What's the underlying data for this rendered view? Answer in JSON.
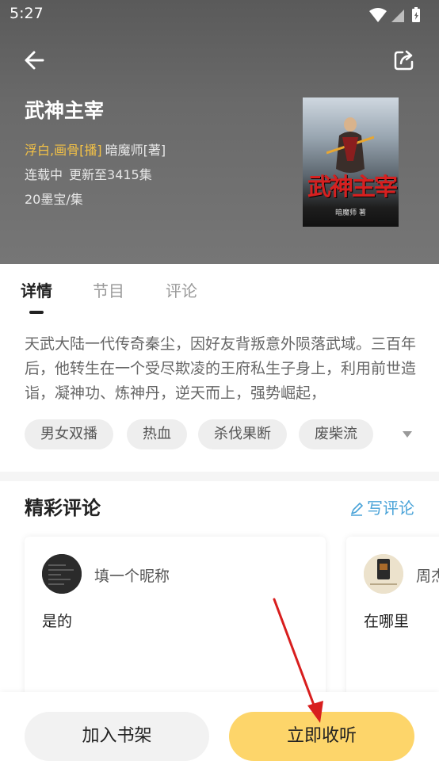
{
  "status_bar": {
    "time": "5:27",
    "icons": [
      "wifi-icon",
      "signal-icon",
      "battery-icon"
    ]
  },
  "header": {
    "back_icon": "back-arrow-icon",
    "share_icon": "share-icon"
  },
  "book": {
    "title": "武神主宰",
    "narrators": "浮白,画骨[播]",
    "author": "暗魔师[著]",
    "status": "连载中",
    "update": "更新至3415集",
    "price": "20墨宝/集",
    "cover": {
      "title": "武神主宰",
      "author": "暗魔师 著"
    }
  },
  "tabs": [
    {
      "label": "详情",
      "active": true
    },
    {
      "label": "节目",
      "active": false
    },
    {
      "label": "评论",
      "active": false
    }
  ],
  "description": "天武大陆一代传奇秦尘，因好友背叛意外陨落武域。三百年后，他转生在一个受尽欺凌的王府私生子身上，利用前世造诣，凝神功、炼神丹，逆天而上，强势崛起，",
  "tags": [
    "男女双播",
    "热血",
    "杀伐果断",
    "废柴流"
  ],
  "comments_section": {
    "title": "精彩评论",
    "write_label": "写评论",
    "items": [
      {
        "name": "填一个昵称",
        "text": "是的"
      },
      {
        "name": "周杰",
        "text": "在哪里"
      }
    ]
  },
  "actions": {
    "add_shelf": "加入书架",
    "listen_now": "立即收听"
  },
  "colors": {
    "accent": "#fdd56a",
    "narrator": "#f4c246",
    "link": "#4aa3d8",
    "annotation_arrow": "#d81e1e"
  }
}
